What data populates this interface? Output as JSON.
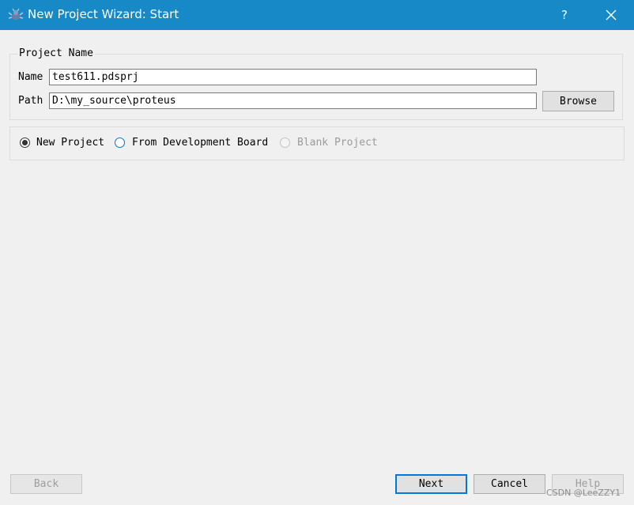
{
  "window": {
    "title": "New Project Wizard: Start",
    "help_label": "?",
    "app_icon": "proteus-app-icon",
    "close_icon": "close-icon"
  },
  "project_name_group": {
    "legend": "Project Name",
    "name_label": "Name",
    "name_value": "test611.pdsprj",
    "path_label": "Path",
    "path_value": "D:\\my_source\\proteus",
    "browse_label": "Browse"
  },
  "project_type": {
    "options": [
      {
        "label": "New Project",
        "selected": true,
        "enabled": true
      },
      {
        "label": "From Development Board",
        "selected": false,
        "enabled": true
      },
      {
        "label": "Blank Project",
        "selected": false,
        "enabled": false
      }
    ]
  },
  "footer": {
    "back_label": "Back",
    "next_label": "Next",
    "cancel_label": "Cancel",
    "help_label": "Help"
  },
  "watermark": "CSDN @LeeZZY1",
  "colors": {
    "titlebar": "#1689c6",
    "focus_border": "#0078d7",
    "background": "#f0f0f0"
  }
}
